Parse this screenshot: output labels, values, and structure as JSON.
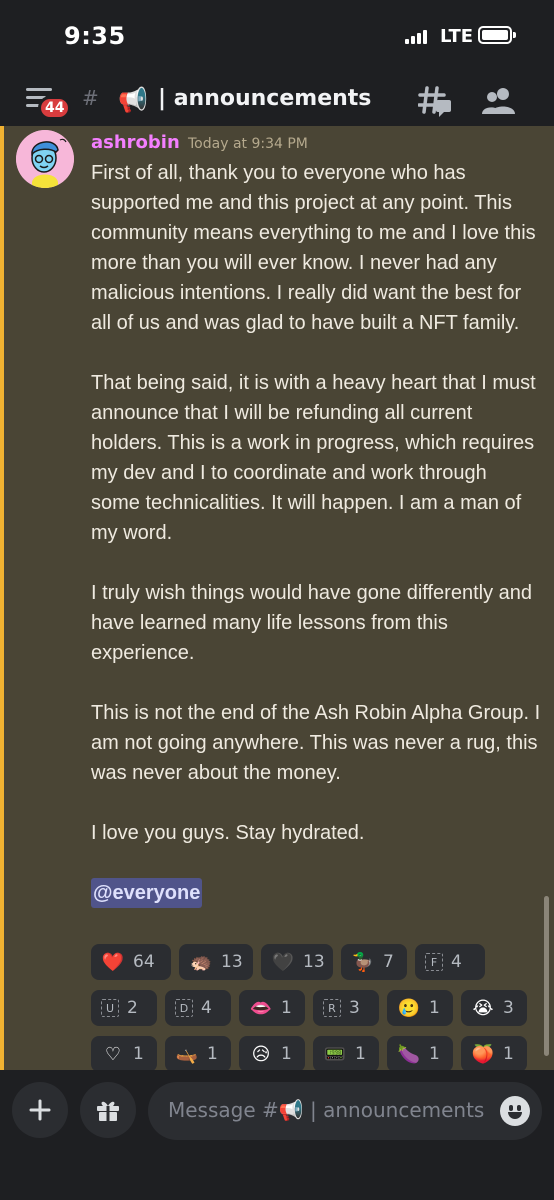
{
  "status": {
    "time": "9:35",
    "network": "LTE"
  },
  "header": {
    "notifications": "44",
    "channel_name": "announcements",
    "channel_icon": "megaphone-icon"
  },
  "message": {
    "author": "ashrobin",
    "author_color": "#f47fff",
    "timestamp": "Today at 9:34 PM",
    "paragraphs": [
      "First of all, thank you to everyone who has supported me and this project at any point. This community means everything to me and I love this more than you will ever know. I never had any malicious intentions. I really did want the best for all of us and was glad to have built a NFT family.",
      "That being said, it is with a heavy heart that I must announce that I will be refunding all current holders. This is a work in progress, which requires my dev and I to coordinate and work through some technicalities. It will happen. I am a man of my word.",
      "I truly wish things would have gone differently and have learned many life lessons from this experience.",
      "This is not the end of the Ash Robin Alpha Group. I am not going anywhere. This was never a rug, this was never about the money.",
      "I love you guys. Stay hydrated."
    ],
    "mention": "@everyone"
  },
  "reactions": [
    {
      "emoji": "❤️",
      "count": "64",
      "name": "heart"
    },
    {
      "emoji": "🦔",
      "count": "13",
      "name": "sonic"
    },
    {
      "emoji": "🖤",
      "count": "13",
      "name": "black-heart"
    },
    {
      "emoji": "🦆",
      "count": "7",
      "name": "duck"
    },
    {
      "emoji": "F",
      "count": "4",
      "name": "letter-f",
      "box": true
    },
    {
      "emoji": "U",
      "count": "2",
      "name": "letter-u",
      "box": true
    },
    {
      "emoji": "D",
      "count": "4",
      "name": "letter-d",
      "box": true
    },
    {
      "emoji": "👄",
      "count": "1",
      "name": "mouth"
    },
    {
      "emoji": "R",
      "count": "3",
      "name": "letter-r",
      "box": true
    },
    {
      "emoji": "🥲",
      "count": "1",
      "name": "smiling-tear"
    },
    {
      "emoji": "😭",
      "count": "3",
      "name": "loudly-crying"
    },
    {
      "emoji": "♡",
      "count": "1",
      "name": "outline-heart"
    },
    {
      "emoji": "🛶",
      "count": "1",
      "name": "boat"
    },
    {
      "emoji": "😥",
      "count": "1",
      "name": "sad-relieved"
    },
    {
      "emoji": "📟",
      "count": "1",
      "name": "pager"
    },
    {
      "emoji": "🍆",
      "count": "1",
      "name": "eggplant"
    },
    {
      "emoji": "🍑",
      "count": "1",
      "name": "peach"
    }
  ],
  "composer": {
    "placeholder": "Message #📢 | announcements"
  }
}
